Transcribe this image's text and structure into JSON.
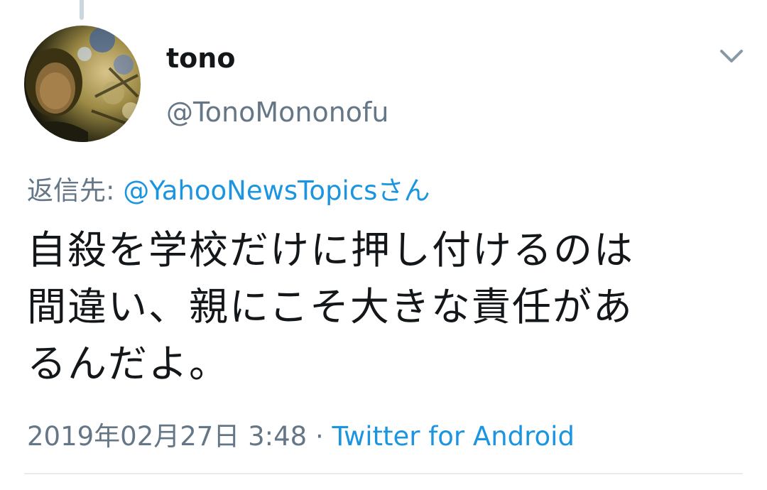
{
  "tweet": {
    "display_name": "tono",
    "handle": "@TonoMononofu",
    "reply_prefix": "返信先: ",
    "reply_to": "@YahooNewsTopics",
    "reply_suffix": "さん",
    "text_lines": [
      "自殺を学校だけに押し付けるのは",
      "間違い、親にこそ大きな責任があ",
      "るんだよ。"
    ],
    "timestamp": "2019年02月27日 3:48",
    "separator": " · ",
    "source": "Twitter for Android"
  },
  "icons": {
    "menu": "chevron-down-icon",
    "avatar": "profile-photo"
  },
  "colors": {
    "text": "#14171a",
    "secondary": "#657786",
    "link": "#1b95e0",
    "divider": "#e6ecf0"
  }
}
